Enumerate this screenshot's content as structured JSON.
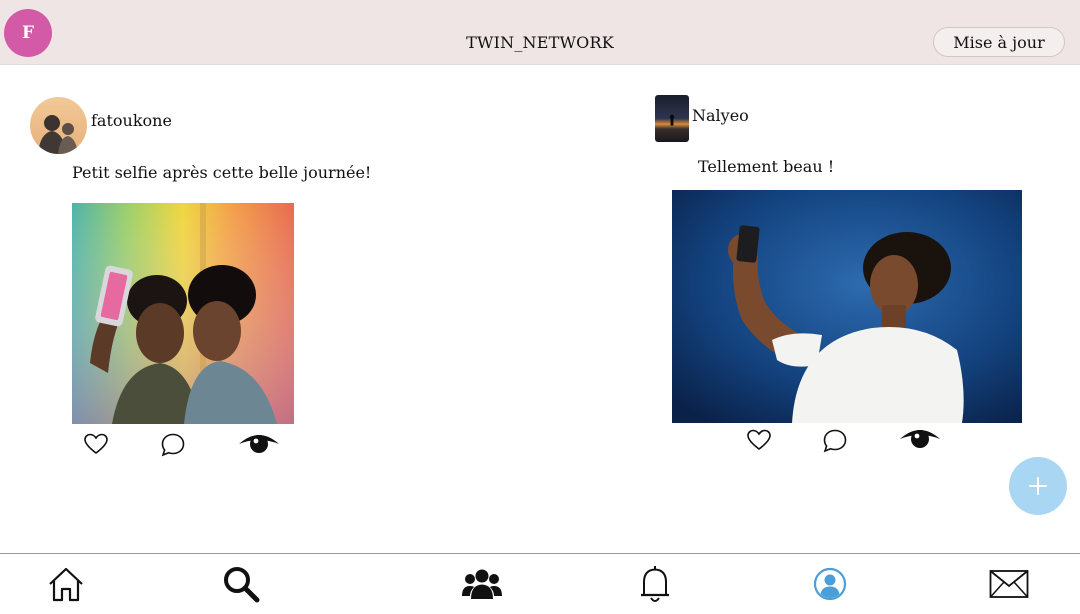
{
  "header": {
    "profile_initial": "F",
    "title": "TWIN_NETWORK",
    "update_button": "Mise à jour"
  },
  "posts": [
    {
      "username": "fatoukone",
      "caption": "Petit selfie après cette belle journée!",
      "actions": [
        "heart-icon",
        "comment-icon",
        "eye-icon"
      ]
    },
    {
      "username": "Nalyeo",
      "caption": "Tellement beau !",
      "actions": [
        "heart-icon",
        "comment-icon",
        "eye-icon"
      ]
    }
  ],
  "fab": {
    "icon": "plus-icon",
    "color": "#a9d6f3"
  },
  "nav": {
    "items": [
      "home-icon",
      "search-icon",
      "group-icon",
      "bell-icon",
      "profile-icon",
      "mail-icon"
    ],
    "active": "profile-icon",
    "active_color": "#4a9fd8"
  },
  "colors": {
    "header_bg": "#efe5e5",
    "avatar_bg": "#d25aa6",
    "active_blue": "#4a9fd8"
  }
}
